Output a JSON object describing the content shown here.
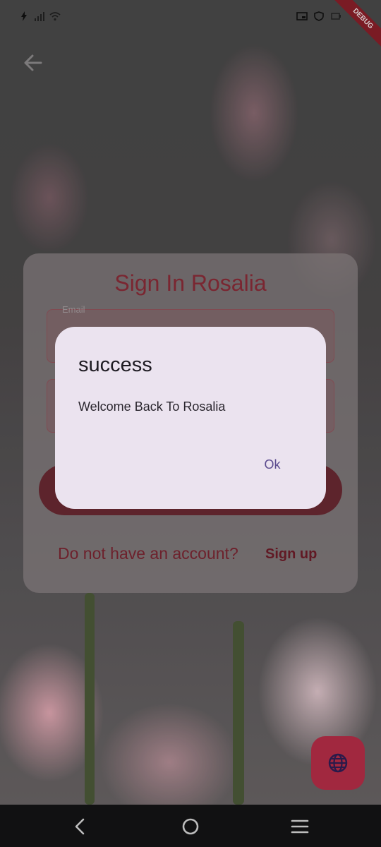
{
  "status_bar": {
    "debug_banner": "DEBUG",
    "left_icons": [
      "charging-icon",
      "signal-icon",
      "wifi-icon"
    ],
    "right_icons": [
      "screen-cast-icon",
      "vpn-shield-icon",
      "battery-icon"
    ]
  },
  "header": {
    "back_icon": "arrow-left-icon"
  },
  "signin_card": {
    "title": "Sign In Rosalia",
    "email_label": "Email",
    "no_account_text": "Do not have an account?",
    "signup_link": "Sign up"
  },
  "dialog": {
    "title": "success",
    "message": "Welcome Back To Rosalia",
    "ok_label": "Ok"
  },
  "fab": {
    "icon": "globe-icon"
  },
  "nav_bar": {
    "buttons": [
      "back-icon",
      "home-icon",
      "menu-icon"
    ]
  },
  "colors": {
    "accent": "#a1283f",
    "dialog_bg": "#ebe3ef",
    "dialog_button": "#5a4a8e",
    "title_red": "#8b2c38"
  }
}
